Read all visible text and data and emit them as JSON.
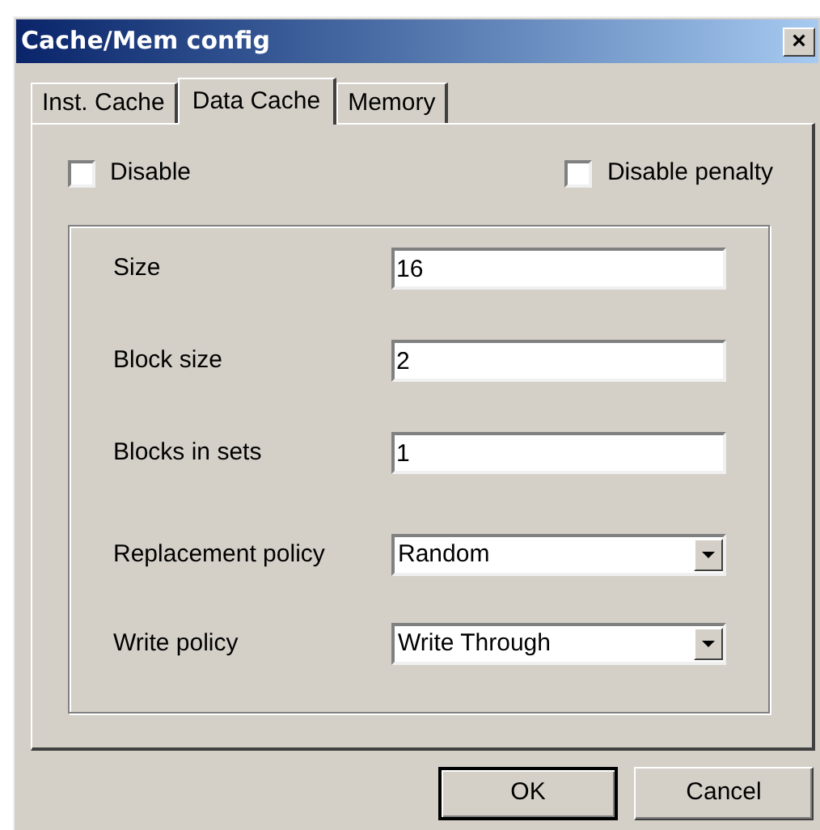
{
  "window": {
    "title": "Cache/Mem config",
    "close": "×"
  },
  "tabs": [
    {
      "label": "Inst. Cache",
      "selected": false
    },
    {
      "label": "Data Cache",
      "selected": true
    },
    {
      "label": "Memory",
      "selected": false
    }
  ],
  "options": [
    {
      "label": "Disable",
      "checked": false
    },
    {
      "label": "Disable penalty",
      "checked": false
    }
  ],
  "fields": [
    {
      "kind": "text",
      "label": "Size",
      "value": "16"
    },
    {
      "kind": "text",
      "label": "Block size",
      "value": "2"
    },
    {
      "kind": "text",
      "label": "Blocks in sets",
      "value": "1"
    },
    {
      "kind": "dropdown",
      "label": "Replacement policy",
      "value": "Random"
    },
    {
      "kind": "dropdown",
      "label": "Write policy",
      "value": "Write Through"
    }
  ],
  "buttons": [
    {
      "label": "OK",
      "default": true
    },
    {
      "label": "Cancel",
      "default": false
    }
  ]
}
